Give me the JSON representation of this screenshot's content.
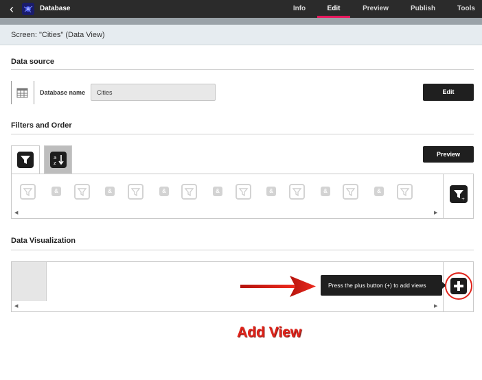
{
  "topbar": {
    "back_icon": "chevron-left-icon",
    "app_logo_icon": "app-logo-icon",
    "app_title": "Database",
    "tabs": [
      {
        "label": "Info",
        "active": false
      },
      {
        "label": "Edit",
        "active": true
      },
      {
        "label": "Preview",
        "active": false
      },
      {
        "label": "Publish",
        "active": false
      },
      {
        "label": "Tools",
        "active": false
      }
    ],
    "accent_color": "#e8175d"
  },
  "screen": {
    "title": "Screen: \"Cities\" (Data View)"
  },
  "data_source": {
    "heading": "Data source",
    "icon": "database-table-icon",
    "name_label": "Database name",
    "name_value": "Cities",
    "edit_button": "Edit"
  },
  "filters": {
    "heading": "Filters and Order",
    "tab_filter_icon": "filter-icon",
    "tab_sort_icon": "sort-az-icon",
    "preview_button": "Preview",
    "chip_icon": "filter-icon",
    "connector_label": "&",
    "add_filter_icon": "add-filter-icon"
  },
  "visualization": {
    "heading": "Data Visualization",
    "tooltip": "Press the plus button (+) to add views",
    "add_icon": "plus-icon"
  },
  "annotation": {
    "label": "Add View",
    "color": "#e0231a"
  }
}
